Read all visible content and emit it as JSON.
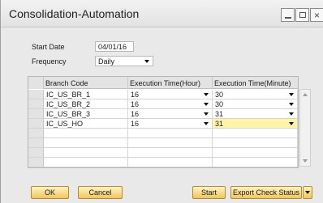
{
  "window": {
    "title": "Consolidation-Automation"
  },
  "form": {
    "start_date_label": "Start Date",
    "start_date_value": "04/01/16",
    "frequency_label": "Frequency",
    "frequency_value": "Daily"
  },
  "grid": {
    "columns": [
      "Branch Code",
      "Execution Time(Hour)",
      "Execution Time(Minute)"
    ],
    "rows": [
      {
        "branch": "IC_US_BR_1",
        "hour": "16",
        "minute": "30"
      },
      {
        "branch": "IC_US_BR_2",
        "hour": "16",
        "minute": "30"
      },
      {
        "branch": "IC_US_BR_3",
        "hour": "16",
        "minute": "31"
      },
      {
        "branch": "IC_US_HO",
        "hour": "16",
        "minute": "31"
      }
    ]
  },
  "buttons": {
    "ok": "OK",
    "cancel": "Cancel",
    "start": "Start",
    "export": "Export Check Status"
  },
  "colors": {
    "accent_button": "#f0c660",
    "selected_cell": "#fff4a8"
  }
}
